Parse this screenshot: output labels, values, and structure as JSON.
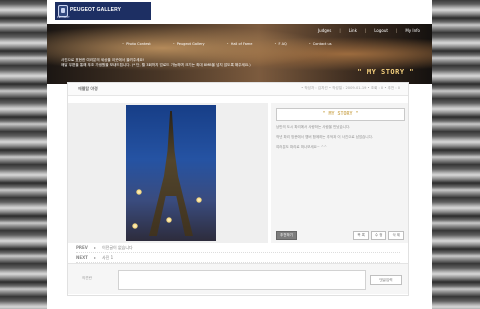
{
  "brand": {
    "name": "PEUGEOT GALLERY",
    "sub": "PEUGEOT"
  },
  "util_nav": [
    {
      "label": "Judges"
    },
    {
      "label": "Link"
    },
    {
      "label": "Logout"
    },
    {
      "label": "My Info"
    }
  ],
  "main_nav": [
    {
      "label": "Photo Contest"
    },
    {
      "label": "Peugeot Gallery"
    },
    {
      "label": "Hall of Fame"
    },
    {
      "label": "F AQ"
    },
    {
      "label": "Contact us"
    }
  ],
  "intro": {
    "line1": "사진으로 표현한 여러분의 세상을 이곳에서 올려주세요!",
    "line2": "매달 우편을 통해 푸조 가생원을 보내드립니다. (* 단, 월 3회까지 업로드 가능하며 크기는 최대 8MB을 넘지 않도록 해주세요.)"
  },
  "section_title": "\" MY STORY \"",
  "post": {
    "title": "에펠탑 야경",
    "meta": "• 작성자 : 김지선  • 작성일 : 2009-01-19  • 조회 : 0  • 추천 : 0"
  },
  "story": {
    "head": "\" MY STORY \"",
    "paragraph1": "낭만의 도시 파리에서 사랑하는 사람을 만났습니다.",
    "paragraph2": "작년 파리 방문에서 멤버 함께하는 추억과 이 사진으로 남았습니다.",
    "paragraph3": "여러분도 파리로 떠나보세요~ ^^"
  },
  "buttons": {
    "recommend": "추천하기",
    "list": "목 록",
    "edit": "수 정",
    "delete": "삭 제",
    "comment_submit": "댓글입력"
  },
  "nav_links": {
    "prev_label": "PREV",
    "prev_text": "이전글이 없습니다",
    "next_label": "NEXT",
    "next_text": "사진 1"
  },
  "comment": {
    "label": "의견란",
    "placeholder": ""
  }
}
